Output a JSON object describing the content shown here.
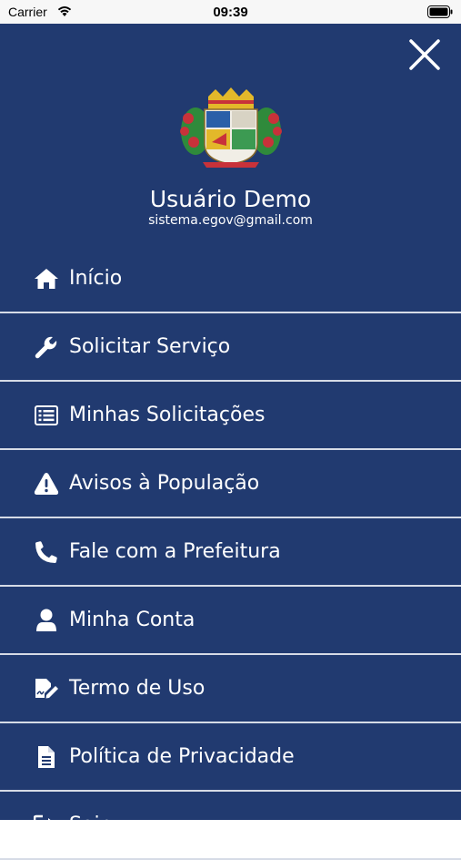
{
  "status_bar": {
    "carrier": "Carrier",
    "time": "09:39"
  },
  "drawer": {
    "background": "#213a70",
    "user": {
      "name": "Usuário Demo",
      "email": "sistema.egov@gmail.com"
    },
    "menu": [
      {
        "label": "Início",
        "icon": "home-icon"
      },
      {
        "label": "Solicitar Serviço",
        "icon": "wrench-icon"
      },
      {
        "label": "Minhas Solicitações",
        "icon": "list-icon"
      },
      {
        "label": "Avisos à População",
        "icon": "warning-icon"
      },
      {
        "label": "Fale com a Prefeitura",
        "icon": "phone-icon"
      },
      {
        "label": "Minha Conta",
        "icon": "user-icon"
      },
      {
        "label": "Termo de Uso",
        "icon": "signature-icon"
      },
      {
        "label": "Política de Privacidade",
        "icon": "document-icon"
      },
      {
        "label": "Sair",
        "icon": "sign-out-icon"
      }
    ]
  }
}
